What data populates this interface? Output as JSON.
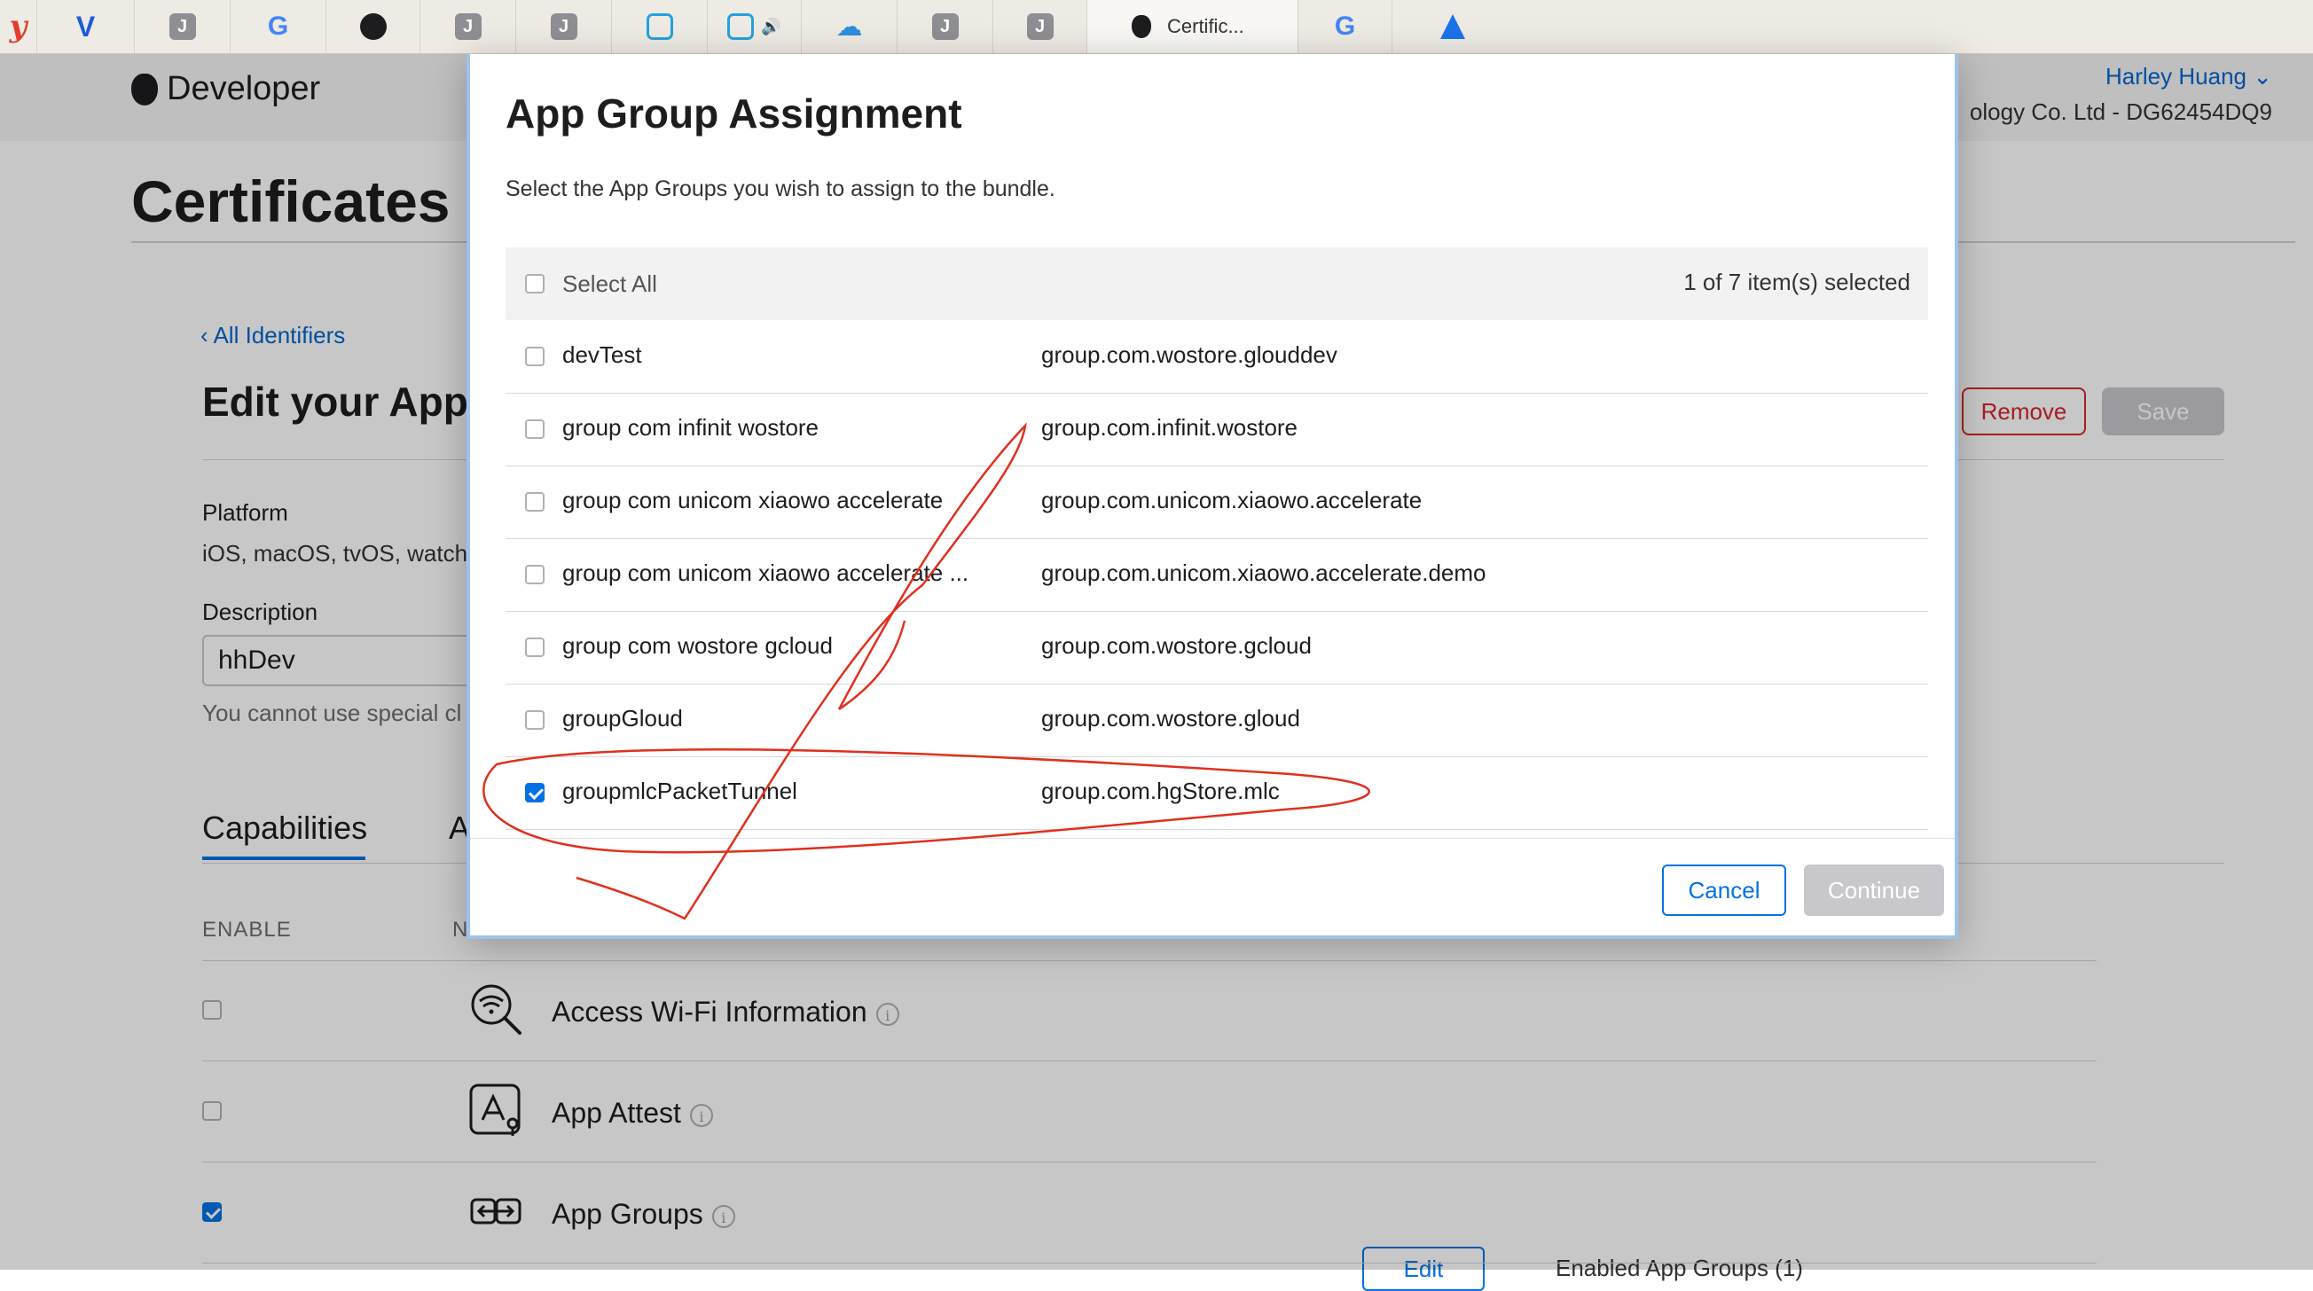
{
  "browser": {
    "tabs": [
      {
        "icon": "yuque-icon",
        "glyph": "y"
      },
      {
        "icon": "v-icon",
        "glyph": "V"
      },
      {
        "icon": "j-icon",
        "glyph": "J"
      },
      {
        "icon": "google-icon",
        "glyph": "G"
      },
      {
        "icon": "github-icon",
        "glyph": ""
      },
      {
        "icon": "j-icon",
        "glyph": "J"
      },
      {
        "icon": "j-icon",
        "glyph": "J"
      },
      {
        "icon": "bilibili-icon",
        "glyph": ""
      },
      {
        "icon": "bilibili-icon",
        "glyph": ""
      },
      {
        "icon": "cloud-icon",
        "glyph": "☁"
      },
      {
        "icon": "j-icon",
        "glyph": "J"
      },
      {
        "icon": "j-icon",
        "glyph": "J"
      },
      {
        "icon": "apple-icon",
        "glyph": "",
        "label": "Certific...",
        "active": true
      },
      {
        "icon": "google-icon",
        "glyph": "G"
      },
      {
        "icon": "atlassian-icon",
        "glyph": ""
      }
    ],
    "speaker_glyph": "🔊"
  },
  "header": {
    "brand": "Developer",
    "user": "Harley Huang ⌄",
    "team": "ology Co. Ltd - DG62454DQ9"
  },
  "page": {
    "title": "Certificates",
    "back_link": "‹ All Identifiers",
    "heading": "Edit your App",
    "remove_label": "Remove",
    "save_label": "Save",
    "platform_label": "Platform",
    "platform_value": "iOS, macOS, tvOS, watch",
    "description_label": "Description",
    "description_value": "hhDev",
    "description_hint": "You cannot use special cl",
    "tab_capabilities": "Capabilities",
    "tab_other": "A",
    "col_enable": "ENABLE",
    "col_name": "N",
    "capabilities": [
      {
        "name": "Access Wi-Fi Information",
        "enabled": false,
        "icon": "wifi-search-icon"
      },
      {
        "name": "App Attest",
        "enabled": false,
        "icon": "app-attest-icon"
      },
      {
        "name": "App Groups",
        "enabled": true,
        "icon": "app-groups-icon"
      }
    ],
    "edit_label": "Edit",
    "enabled_groups": "Enabled App Groups (1)"
  },
  "modal": {
    "title": "App Group Assignment",
    "subtitle": "Select the App Groups you wish to assign to the bundle.",
    "select_all": "Select All",
    "selection_count": "1 of 7 item(s) selected",
    "groups": [
      {
        "name": "devTest",
        "id": "group.com.wostore.glouddev",
        "checked": false
      },
      {
        "name": "group com infinit wostore",
        "id": "group.com.infinit.wostore",
        "checked": false
      },
      {
        "name": "group com unicom xiaowo accelerate",
        "id": "group.com.unicom.xiaowo.accelerate",
        "checked": false
      },
      {
        "name": "group com unicom xiaowo accelerate ...",
        "id": "group.com.unicom.xiaowo.accelerate.demo",
        "checked": false
      },
      {
        "name": "group com wostore gcloud",
        "id": "group.com.wostore.gcloud",
        "checked": false
      },
      {
        "name": "groupGloud",
        "id": "group.com.wostore.gloud",
        "checked": false
      },
      {
        "name": "groupmlcPacketTunnel",
        "id": "group.com.hgStore.mlc",
        "checked": true
      }
    ],
    "cancel_label": "Cancel",
    "continue_label": "Continue"
  },
  "colors": {
    "accent": "#0071e3",
    "danger": "#d7262b",
    "annotation": "#e0301e"
  }
}
